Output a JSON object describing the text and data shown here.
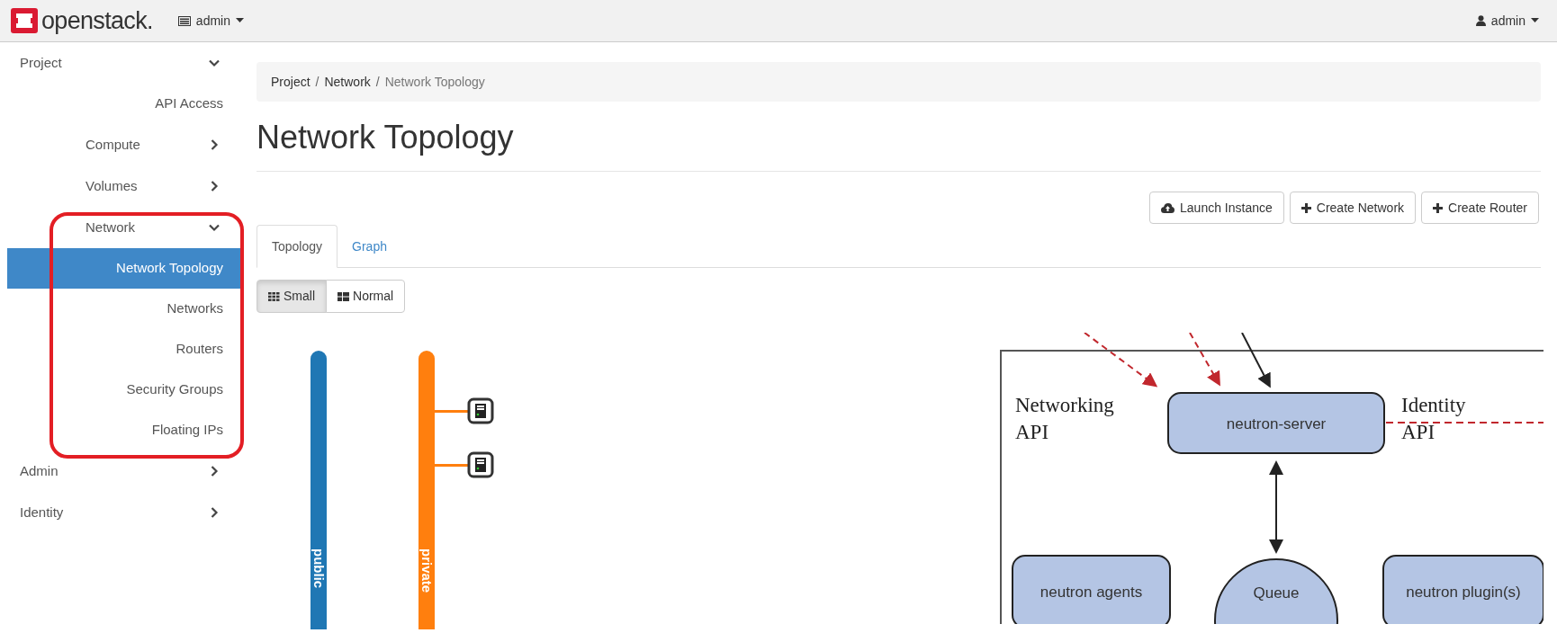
{
  "header": {
    "logo_text": "openstack.",
    "project_menu": "admin",
    "user_menu": "admin"
  },
  "sidebar": {
    "items": [
      {
        "label": "Project",
        "expanded": true,
        "selected": false,
        "children": [
          {
            "label": "API Access",
            "selected": false
          },
          {
            "label": "Compute",
            "expanded": false,
            "selected": false
          },
          {
            "label": "Volumes",
            "expanded": false,
            "selected": false
          },
          {
            "label": "Network",
            "expanded": true,
            "selected": false,
            "children": [
              {
                "label": "Network Topology",
                "selected": true
              },
              {
                "label": "Networks",
                "selected": false
              },
              {
                "label": "Routers",
                "selected": false
              },
              {
                "label": "Security Groups",
                "selected": false
              },
              {
                "label": "Floating IPs",
                "selected": false
              }
            ]
          }
        ]
      },
      {
        "label": "Admin",
        "expanded": false,
        "selected": false
      },
      {
        "label": "Identity",
        "expanded": false,
        "selected": false
      }
    ]
  },
  "breadcrumb": {
    "separator": "/",
    "items": [
      {
        "label": "Project",
        "current": false
      },
      {
        "label": "Network",
        "current": false
      },
      {
        "label": "Network Topology",
        "current": true
      }
    ]
  },
  "page_title": "Network Topology",
  "actions": [
    {
      "label": "Launch Instance",
      "kind": "launch"
    },
    {
      "label": "Create Network",
      "kind": "create"
    },
    {
      "label": "Create Router",
      "kind": "create"
    }
  ],
  "tabs": [
    {
      "label": "Topology",
      "selected": true
    },
    {
      "label": "Graph",
      "selected": false
    }
  ],
  "view_toggle": [
    {
      "label": "Small",
      "kind": "small",
      "selected": true
    },
    {
      "label": "Normal",
      "kind": "normal",
      "selected": false
    }
  ],
  "topology": {
    "networks": [
      {
        "name": "public",
        "color": "#1f77b4"
      },
      {
        "name": "private",
        "color": "#ff7f0e",
        "instances": [
          {
            "kind": "server"
          },
          {
            "kind": "server"
          }
        ]
      }
    ]
  },
  "diagram": {
    "left_label": [
      "Networking",
      "API"
    ],
    "right_label": [
      "Identity",
      "API"
    ],
    "nodes": [
      {
        "label": "neutron-server",
        "kind": "box"
      },
      {
        "label": "neutron agents",
        "kind": "box"
      },
      {
        "label": "Queue",
        "kind": "circle"
      },
      {
        "label": "neutron plugin(s)",
        "kind": "box"
      }
    ]
  }
}
